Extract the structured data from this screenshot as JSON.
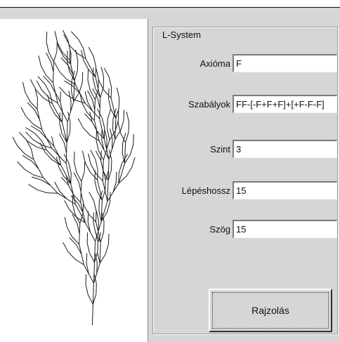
{
  "group_title": "L-System",
  "fields": {
    "axiom": {
      "label": "Axióma",
      "value": "F"
    },
    "rules": {
      "label": "Szabályok",
      "value": "FF-[-F+F+F]+[+F-F-F]"
    },
    "level": {
      "label": "Szint",
      "value": "3"
    },
    "step": {
      "label": "Lépéshossz",
      "value": "15"
    },
    "angle": {
      "label": "Szög",
      "value": "15"
    }
  },
  "draw_button": "Rajzolás",
  "colors": {
    "panel": "#d6d6d6",
    "canvas": "#ffffff",
    "stroke": "#1a1a1a"
  }
}
